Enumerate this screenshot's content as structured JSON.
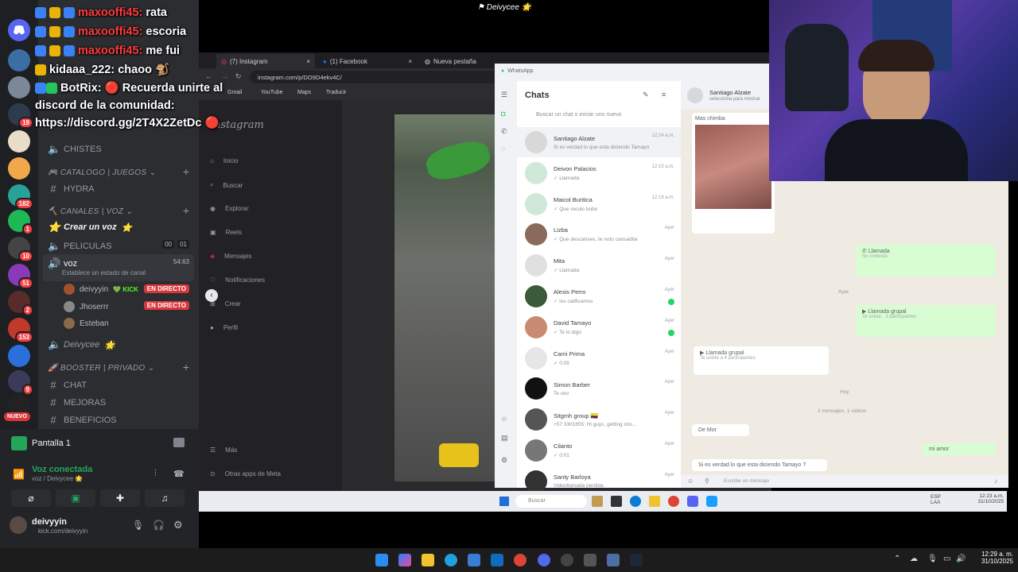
{
  "window_title": "Deivycee 🌟",
  "chat_overlay": [
    {
      "user": "maxooffi45:",
      "text": "rata",
      "color": "#ff3b3b"
    },
    {
      "user": "maxooffi45:",
      "text": "escoria",
      "color": "#ff3b3b"
    },
    {
      "user": "maxooffi45:",
      "text": "me fui",
      "color": "#ff3b3b"
    },
    {
      "user": "kidaaa_222:",
      "text": "chaoo 🐒",
      "color": "#ffffff"
    },
    {
      "user": "BotRix:",
      "text": "🔴 Recuerda unirte al discord de la comunidad: https://discord.gg/2T4X2ZetDc 🔴",
      "color": "#ffffff"
    }
  ],
  "discord": {
    "rail_badges": [
      "19",
      "182",
      "1",
      "10",
      "51",
      "2",
      "153",
      "9",
      "NUEVO"
    ],
    "sidebar": {
      "channel_chistes": "CHISTES",
      "cat_catalogo": "CATALOGO | JUEGOS",
      "channel_hydra": "HYDRA",
      "cat_canales": "CANALES | VOZ",
      "crear_voz": "Crear un voz",
      "channel_peliculas": "PELICULAS",
      "peliculas_count_a": "00",
      "peliculas_count_b": "01",
      "channel_voz": "voz",
      "voz_timer": "54:63",
      "voz_status": "Establece un estado de canal",
      "users": [
        {
          "name": "deivyyin",
          "tag": "KICK",
          "live": "EN DIRECTO"
        },
        {
          "name": "Jhoserrr",
          "tag": "",
          "live": "EN DIRECTO"
        },
        {
          "name": "Esteban",
          "tag": "",
          "live": ""
        }
      ],
      "deivycee": "Deivycee",
      "cat_booster": "BOOSTER | PRIVADO",
      "channel_chat": "CHAT",
      "channel_mejoras": "MEJORAS",
      "channel_beneficios": "BENEFICIOS"
    },
    "screen_share": "Pantalla 1",
    "voice_status": "Voz conectada",
    "voice_channel": "voz / Deivycee 🌟",
    "username": "deivyyin",
    "user_sub": "kick.com/deivyyin"
  },
  "browser": {
    "tabs": [
      "(7) Instagram",
      "(1) Facebook",
      "Nueva pestaña"
    ],
    "url": "instagram.com/p/DO9D4ekv4C/",
    "bookmarks": [
      "Gmail",
      "YouTube",
      "Maps",
      "Traducir"
    ],
    "ig_logo": "Instagram",
    "ig_nav": [
      "Inicio",
      "Buscar",
      "Explorar",
      "Reels",
      "Mensajes",
      "Notificaciones",
      "Crear",
      "Perfil"
    ],
    "ig_more": [
      "Más",
      "Otras apps de Meta"
    ]
  },
  "whatsapp": {
    "title": "WhatsApp",
    "header": "Chats",
    "search_placeholder": "Buscar un chat o iniciar uno nuevo",
    "chats": [
      {
        "name": "Santiago Alzate",
        "preview": "Si es verdad lo que esta diciendo Tamayo",
        "time": "12:24 a.m.",
        "unread": false
      },
      {
        "name": "Deivon Palacios",
        "preview": "✓ Llamada",
        "time": "12:15 a.m.",
        "unread": false
      },
      {
        "name": "Maicol Buritica",
        "preview": "✓ Que reculo bobo",
        "time": "12:19 a.m.",
        "unread": false
      },
      {
        "name": "Lizba",
        "preview": "✓ Que descanses, te noto cansadita",
        "time": "Ayer",
        "unread": false
      },
      {
        "name": "Mita",
        "preview": "✓ Llamada",
        "time": "Ayer",
        "unread": false
      },
      {
        "name": "Alexis Perro",
        "preview": "✓ los calificamos",
        "time": "Ayer",
        "unread": true
      },
      {
        "name": "David Tamayo",
        "preview": "✓ Te lo digo",
        "time": "Ayer",
        "unread": true
      },
      {
        "name": "Cami Prima",
        "preview": "✓ 0:05",
        "time": "Ayer",
        "unread": false
      },
      {
        "name": "Simon Barber",
        "preview": "Te veo",
        "time": "Ayer",
        "unread": false
      },
      {
        "name": "Sitgmh group 🇨🇴",
        "preview": "+57 3301855: Hi guys, getting into...",
        "time": "Ayer",
        "unread": false
      },
      {
        "name": "Cilanto",
        "preview": "✓ 0:01",
        "time": "Ayer",
        "unread": false
      },
      {
        "name": "Santy Barloya",
        "preview": "Videollamada perdida",
        "time": "Ayer",
        "unread": false
      }
    ],
    "contact_name": "Santiago Alzate",
    "contact_sub": "selecciona para mostrar",
    "messages": [
      {
        "dir": "in",
        "text": "Mas chimba",
        "time": "12:..."
      },
      {
        "dir": "out",
        "text": "Llamada",
        "sub": "No contestó",
        "time": "12:28"
      },
      {
        "dir": "sys",
        "text": "Ayer"
      },
      {
        "dir": "out",
        "text": "Llamada grupal",
        "sub": "Te uniste · 3 participantes",
        "time": ""
      },
      {
        "dir": "in",
        "text": "Llamada grupal",
        "sub": "Te uniste a 4 participantes",
        "time": ""
      },
      {
        "dir": "sys",
        "text": "Hoy"
      },
      {
        "dir": "sys",
        "text": "2 mensajes, 1 videos"
      },
      {
        "dir": "in",
        "text": "De Mor",
        "time": "12:24"
      },
      {
        "dir": "out",
        "text": "mi amor",
        "time": "12:24"
      },
      {
        "dir": "in",
        "text": "Si es verdad lo que esta diciendo Tamayo ?",
        "time": "12:24"
      }
    ],
    "compose_placeholder": "Escribe un mensaje"
  },
  "inner_taskbar": {
    "search": "Buscar",
    "time": "12:23 a.m.",
    "date": "31/10/2025",
    "lang": "ESP LAA"
  },
  "taskbar": {
    "time": "12:29 a. m.",
    "date": "31/10/2025"
  }
}
